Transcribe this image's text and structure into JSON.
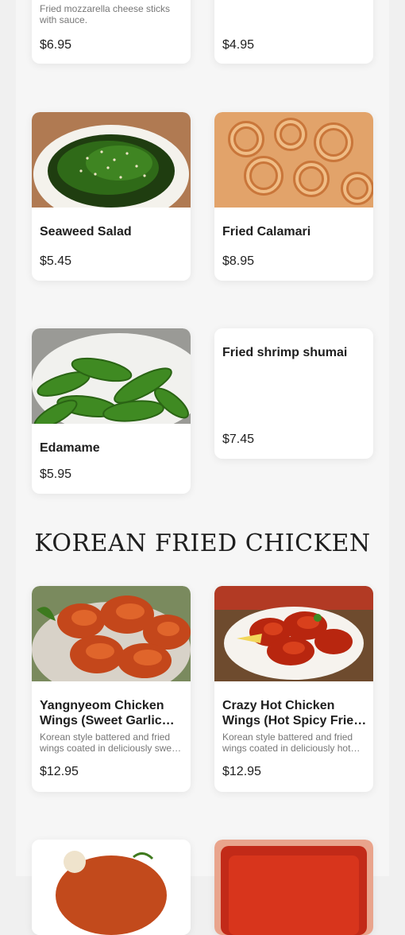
{
  "partial_items": [
    {
      "description": "Fried mozzarella cheese sticks with sauce.",
      "price": "$6.95"
    },
    {
      "price": "$4.95"
    }
  ],
  "items": [
    {
      "name": "Seaweed Salad",
      "price": "$5.45"
    },
    {
      "name": "Fried Calamari",
      "price": "$8.95"
    },
    {
      "name": "Edamame",
      "price": "$5.95"
    },
    {
      "name": "Fried shrimp shumai",
      "price": "$7.45"
    }
  ],
  "section": {
    "title": "KOREAN FRIED CHICKEN"
  },
  "chicken_items": [
    {
      "name": "Yangnyeom Chicken Wings (Sweet Garlic Sauce)",
      "description": "Korean style battered and fried wings coated in deliciously sweet garlic sauce.",
      "price": "$12.95"
    },
    {
      "name": "Crazy Hot Chicken Wings (Hot Spicy Fried Sauce)",
      "description": "Korean style battered and fried wings coated in deliciously hot spicy sauce.",
      "price": "$12.95"
    }
  ]
}
